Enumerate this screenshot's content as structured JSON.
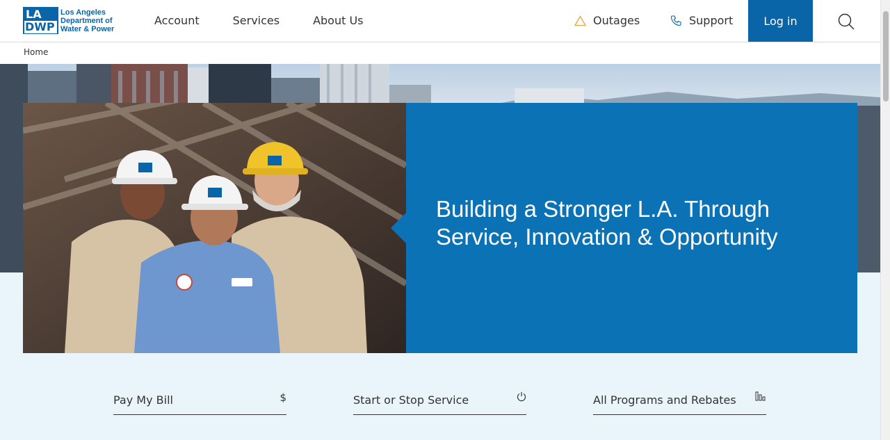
{
  "brand": {
    "logo_top": "LA",
    "logo_bottom": "DWP",
    "name_line1": "Los Angeles",
    "name_line2": "Department of",
    "name_line3": "Water & Power"
  },
  "nav": [
    {
      "label": "Account"
    },
    {
      "label": "Services"
    },
    {
      "label": "About Us"
    }
  ],
  "utility": {
    "outages_label": "Outages",
    "support_label": "Support",
    "login_label": "Log in"
  },
  "breadcrumb": {
    "home": "Home"
  },
  "hero": {
    "title": "Building a Stronger L.A. Through Service, Innovation & Opportunity"
  },
  "quick_links": [
    {
      "label": "Pay My Bill",
      "icon": "dollar-icon"
    },
    {
      "label": "Start or Stop Service",
      "icon": "power-icon"
    },
    {
      "label": "All Programs and Rebates",
      "icon": "bar-chart-icon"
    }
  ],
  "colors": {
    "brand_blue": "#0a64a8",
    "hero_panel": "#0a72b5",
    "light_bg": "#eaf4fb",
    "warning": "#e8a33d"
  }
}
